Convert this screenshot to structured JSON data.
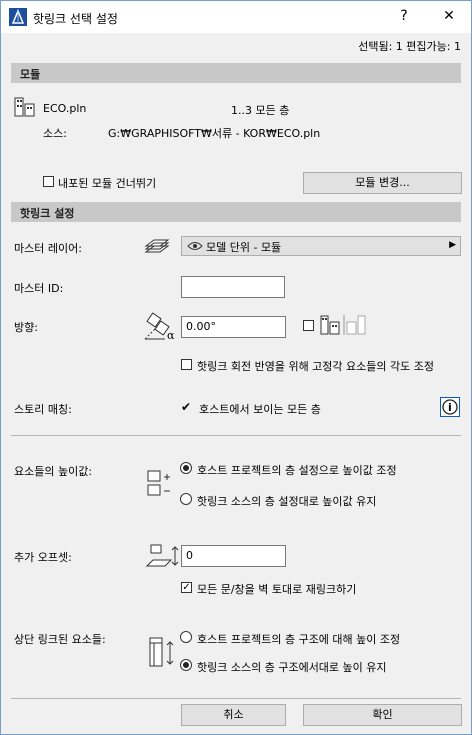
{
  "window": {
    "title": "핫링크 선택 설정",
    "help_label": "?",
    "close_label": "✕"
  },
  "status_text": "선택됨: 1 편집가능: 1",
  "module_section": {
    "header": "모듈",
    "file_name": "ECO.pln",
    "story_info": "1..3 모든 층",
    "source_label": "소스:",
    "source_path": "G:₩GRAPHISOFT₩서류 - KOR₩ECO.pln",
    "skip_nested_label": "내포된 모듈 건너뛰기",
    "skip_nested_checked": false,
    "change_module_label": "모듈 변경..."
  },
  "hotlink_section": {
    "header": "핫링크 설정",
    "master_layer_label": "마스터 레이어:",
    "master_layer_value": "모델 단위 - 모듈",
    "master_id_label": "마스터 ID:",
    "master_id_value": "",
    "orientation_label": "방향:",
    "orientation_value": "0.00°",
    "mirror_checked": false,
    "adjust_angle_label": "핫링크 회전 반영을 위해 고정각 요소들의 각도 조정",
    "adjust_angle_checked": false,
    "story_matching_label": "스토리 매칭:",
    "story_matching_value": "호스트에서 보이는 모든 층",
    "story_matching_check": "✔",
    "info_label": "i"
  },
  "elevation_section": {
    "elevation_label": "요소들의 높이값:",
    "elevation_options": [
      {
        "label": "호스트 프로젝트의 층 설정으로 높이값 조정",
        "selected": true
      },
      {
        "label": "핫링크 소스의 층 설정대로 높이값 유지",
        "selected": false
      }
    ],
    "offset_label": "추가 오프셋:",
    "offset_value": "0",
    "relink_label": "모든 문/창을 벽 토대로 재링크하기",
    "relink_checked": true,
    "top_linked_label": "상단 링크된 요소들:",
    "top_linked_options": [
      {
        "label": "호스트 프로젝트의 층 구조에 대해 높이 조정",
        "selected": false
      },
      {
        "label": "핫링크 소스의 층 구조에서대로 높이 유지",
        "selected": true
      }
    ]
  },
  "footer": {
    "cancel_label": "취소",
    "ok_label": "확인"
  }
}
